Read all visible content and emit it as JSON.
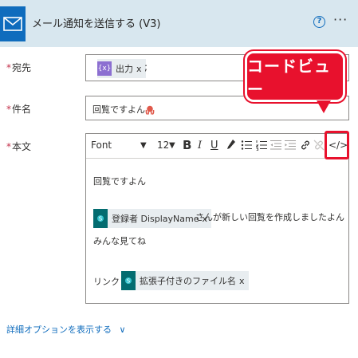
{
  "header": {
    "title": "メール通知を送信する (V3)",
    "help_icon": "?",
    "more_icon": "···"
  },
  "to": {
    "label": "宛先",
    "required_mark": "*",
    "token": {
      "text": "出力",
      "remove": "x",
      "icon": "{x}"
    },
    "separator": ";"
  },
  "subject": {
    "label": "件名",
    "required_mark": "*",
    "value": "回覧ですよん"
  },
  "body": {
    "label": "本文",
    "required_mark": "*",
    "toolbar": {
      "font": "Font",
      "font_arrow": "▼",
      "size": "12",
      "size_arrow": "▼",
      "bold": "B",
      "italic": "I",
      "underline": "U",
      "code_view": "</>"
    },
    "line1": "回覧ですよん",
    "token1": {
      "text": "登録者 DisplayName",
      "remove": "x"
    },
    "line2_after": "さんが新しい回覧を作成しましたよん",
    "line3": "みんな見てね",
    "link_label": "リンク：",
    "token2": {
      "text": "拡張子付きのファイル名",
      "remove": "x"
    }
  },
  "callout": {
    "text": "コードビュー"
  },
  "advanced": {
    "text": "詳細オプションを表示する",
    "chevron": "∨"
  },
  "colors": {
    "accent": "#0f6cbd",
    "header_bg": "#d8e7ef",
    "callout_red": "#e8112d",
    "sharepoint": "#036c70",
    "dynamic": "#8c6fd1"
  }
}
